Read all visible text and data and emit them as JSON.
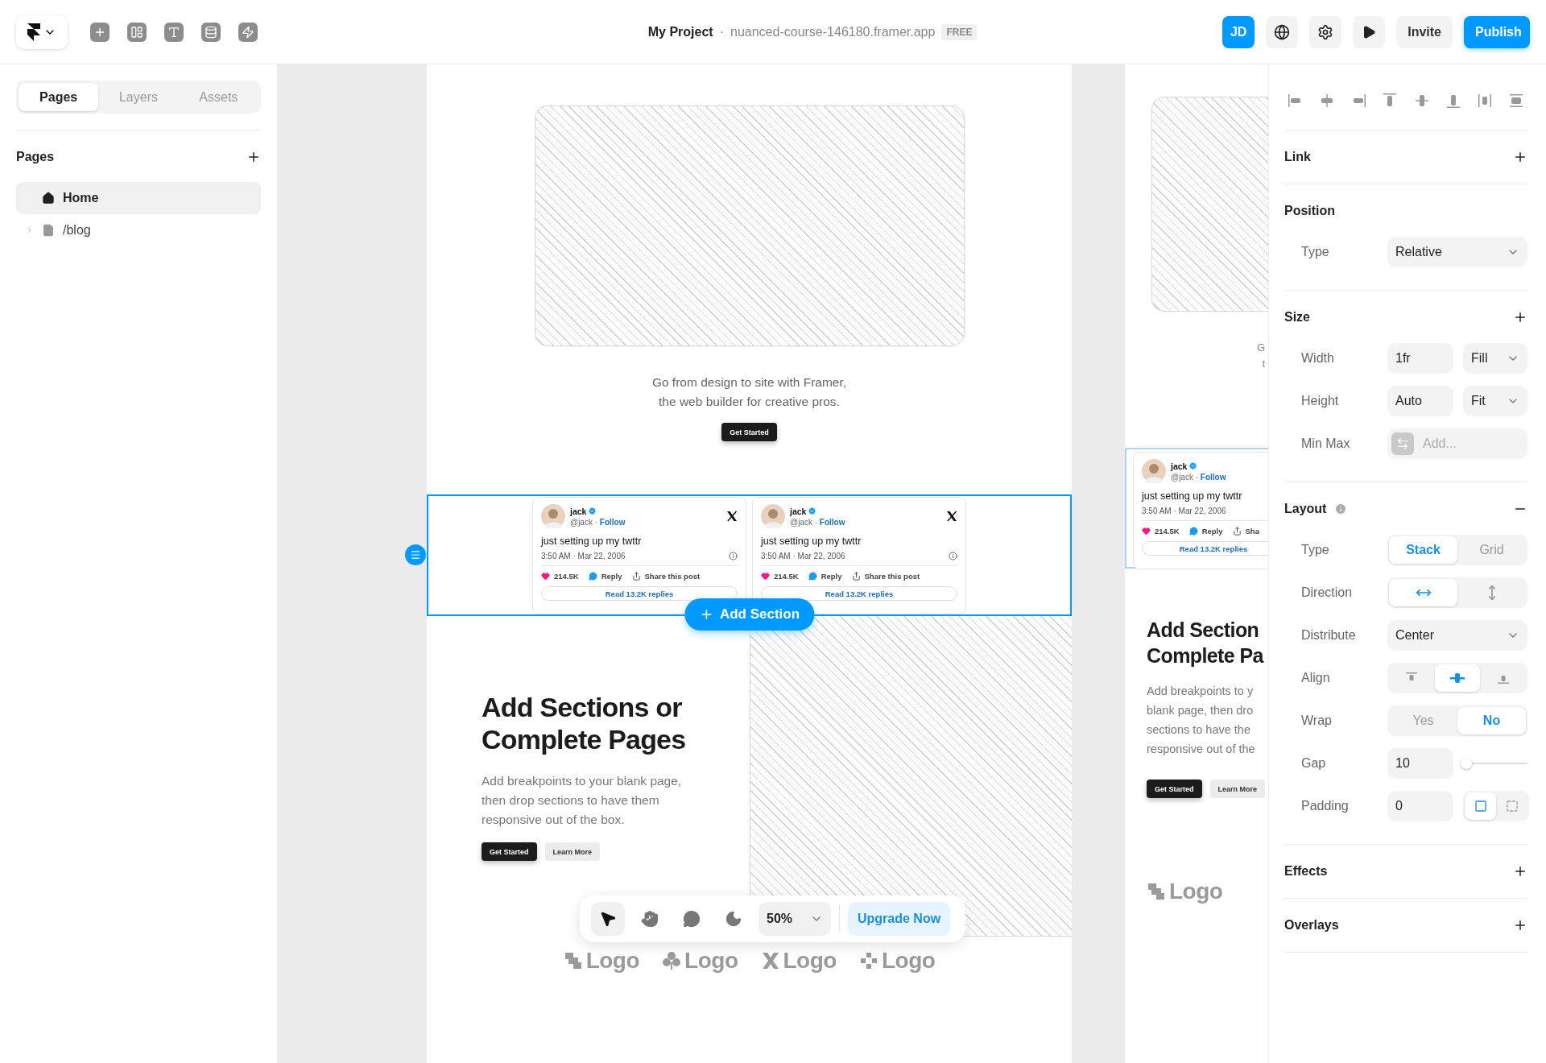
{
  "top_bar": {
    "project": "My Project",
    "separator": "·",
    "url": "nuanced-course-146180.framer.app",
    "plan": "FREE",
    "avatar": "JD",
    "invite": "Invite",
    "publish": "Publish"
  },
  "left_panel": {
    "tabs": [
      {
        "label": "Pages",
        "selected": true
      },
      {
        "label": "Layers",
        "selected": false
      },
      {
        "label": "Assets",
        "selected": false
      }
    ],
    "title": "Pages",
    "pages": [
      {
        "label": "Home",
        "kind": "home",
        "selected": true
      },
      {
        "label": "/blog",
        "kind": "file",
        "selected": false,
        "expanded": false
      }
    ]
  },
  "canvas": {
    "intro": "Go from design to site with Framer, the web builder for creative pros.",
    "intro_button": "Get Started",
    "tweets": [
      {
        "name": "jack",
        "handle": "@jack",
        "separator": "·",
        "follow": "Follow",
        "text": "just setting up my twttr",
        "time": "3:50 AM · Mar 22, 2006",
        "likes": "214.5K",
        "reply": "Reply",
        "share": "Share this post",
        "replies": "Read 13.2K replies"
      },
      {
        "name": "jack",
        "handle": "@jack",
        "separator": "·",
        "follow": "Follow",
        "text": "just setting up my twttr",
        "time": "3:50 AM · Mar 22, 2006",
        "likes": "214.5K",
        "reply": "Reply",
        "share": "Share this post",
        "replies": "Read 13.2K replies"
      }
    ],
    "add_section": "Add Section",
    "feature": {
      "heading": "Add Sections or Complete Pages",
      "body": "Add breakpoints to your blank page, then drop sections to have them responsive out of the box.",
      "primary": "Get Started",
      "secondary": "Learn More"
    },
    "logos": [
      {
        "label": "Logo"
      },
      {
        "label": "Logo"
      },
      {
        "label": "Logo"
      },
      {
        "label": "Logo"
      }
    ],
    "toolbar": {
      "tools": [
        {
          "selected": true
        },
        {
          "selected": false
        },
        {
          "selected": false
        },
        {
          "selected": false
        }
      ],
      "zoom": "50%",
      "upgrade": "Upgrade Now"
    },
    "preview": {
      "fragments": [
        "G",
        "t"
      ],
      "tweet": {
        "name": "jack",
        "handle": "@jack",
        "separator": "·",
        "follow": "Follow",
        "text": "just setting up my twttr",
        "time": "3:50 AM · Mar 22, 2006",
        "likes": "214.5K",
        "reply": "Reply",
        "share": "Sha",
        "replies": "Read 13.2K replies"
      },
      "heading_lines": [
        "Add Section",
        "Complete Pa"
      ],
      "body_lines": [
        "Add breakpoints to y",
        "blank page, then dro",
        "sections to have the",
        "responsive out of the"
      ],
      "primary": "Get Started",
      "secondary": "Learn More",
      "logo": {
        "label": "Logo"
      }
    }
  },
  "right_panel": {
    "sections": [
      {
        "title": "Link",
        "expanded": false
      },
      {
        "title": "Position",
        "rows": [
          {
            "kind": "dropdown",
            "label": "Type",
            "value": "Relative"
          }
        ]
      },
      {
        "title": "Size",
        "expanded": false,
        "rows": [
          {
            "kind": "field_dropdown",
            "label": "Width",
            "value": "1fr",
            "option": "Fill"
          },
          {
            "kind": "field_dropdown",
            "label": "Height",
            "value": "Auto",
            "option": "Fit"
          },
          {
            "kind": "minmax",
            "label": "Min Max",
            "placeholder": "Add..."
          }
        ]
      },
      {
        "title": "Layout",
        "expanded": true,
        "info": true,
        "rows": [
          {
            "kind": "segmented",
            "label": "Type",
            "options": [
              {
                "label": "Stack",
                "selected": true
              },
              {
                "label": "Grid",
                "selected": false
              }
            ]
          },
          {
            "kind": "direction",
            "label": "Direction",
            "options": [
              {
                "selected": true
              },
              {
                "selected": false
              }
            ]
          },
          {
            "kind": "dropdown",
            "label": "Distribute",
            "value": "Center"
          },
          {
            "kind": "align",
            "label": "Align",
            "options": [
              {
                "selected": false
              },
              {
                "selected": true
              },
              {
                "selected": false
              }
            ]
          },
          {
            "kind": "segmented",
            "label": "Wrap",
            "options": [
              {
                "label": "Yes",
                "selected": false
              },
              {
                "label": "No",
                "selected": true
              }
            ]
          },
          {
            "kind": "field_slider",
            "label": "Gap",
            "value": "10",
            "level": 0.05
          },
          {
            "kind": "padding",
            "label": "Padding",
            "value": "0",
            "options": [
              {
                "selected": true
              },
              {
                "selected": false
              }
            ]
          }
        ]
      },
      {
        "title": "Effects",
        "expanded": false
      },
      {
        "title": "Overlays",
        "expanded": false
      }
    ]
  }
}
